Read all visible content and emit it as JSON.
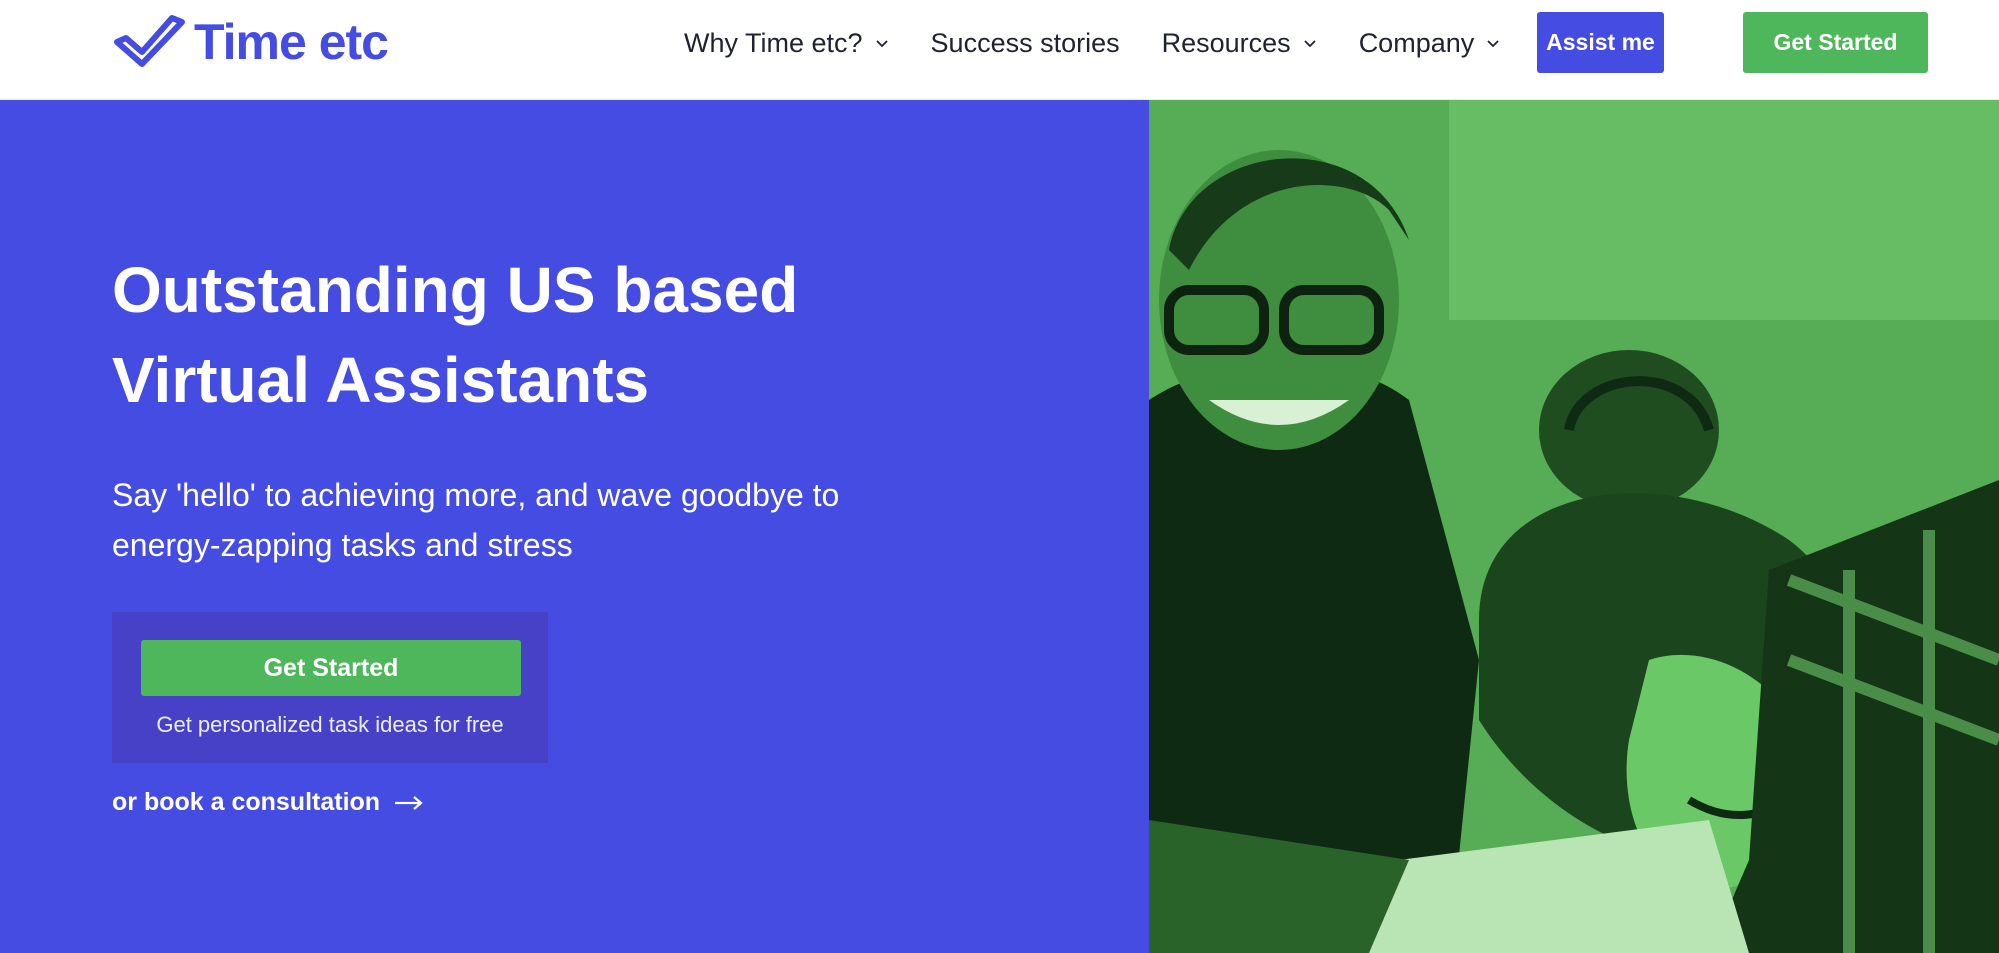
{
  "header": {
    "logo_text": "Time etc",
    "nav": [
      {
        "label": "Why Time etc?",
        "has_dropdown": true
      },
      {
        "label": "Success stories",
        "has_dropdown": false
      },
      {
        "label": "Resources",
        "has_dropdown": true
      },
      {
        "label": "Company",
        "has_dropdown": true
      }
    ],
    "assist_label": "Assist me",
    "get_started_label": "Get Started"
  },
  "hero": {
    "title_line1": "Outstanding US based",
    "title_line2": "Virtual Assistants",
    "subtitle_line1": "Say 'hello' to achieving more, and wave goodbye to",
    "subtitle_line2": "energy-zapping tasks and stress",
    "cta_label": "Get Started",
    "cta_note": "Get personalized task ideas for free",
    "consult_label": "or book a consultation",
    "image": "photo-of-smiling-woman-and-man-green-tint"
  },
  "colors": {
    "brand_blue": "#444ce2",
    "brand_green": "#4fb75b",
    "cta_box": "#4741c8",
    "photo_tint": "#4fa34f"
  },
  "icons": [
    "logo-check-icon",
    "chevron-down-icon",
    "arrow-right-icon"
  ]
}
